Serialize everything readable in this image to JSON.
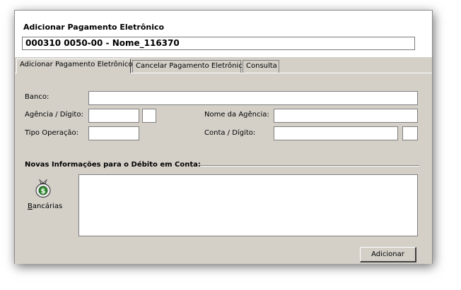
{
  "window": {
    "title": "Adicionar Pagamento Eletrônico",
    "record": "000310 0050-00 - Nome_116370"
  },
  "tabs": [
    {
      "label": "Adicionar Pagamento Eletrônico",
      "active": true
    },
    {
      "label": "Cancelar Pagamento Eletrônico",
      "active": false
    },
    {
      "label": "Consulta",
      "active": false
    }
  ],
  "form": {
    "banco_label": "Banco:",
    "banco_value": "",
    "agencia_label": "Agência / Dígito:",
    "agencia_value": "",
    "agencia_digito_value": "",
    "nome_agencia_label": "Nome da Agência:",
    "nome_agencia_value": "",
    "tipo_operacao_label": "Tipo Operação:",
    "tipo_operacao_value": "",
    "conta_label": "Conta / Dígito:",
    "conta_value": "",
    "conta_digito_value": ""
  },
  "section": {
    "title": "Novas Informações para o Débito em Conta:",
    "bank_button_label_first": "B",
    "bank_button_label_rest": "ancárias",
    "bank_icon": "money-bag-icon",
    "info_text": ""
  },
  "actions": {
    "add_label": "Adicionar"
  },
  "colors": {
    "panel": "#d4d0c8",
    "accent_green": "#2e8b2e"
  }
}
